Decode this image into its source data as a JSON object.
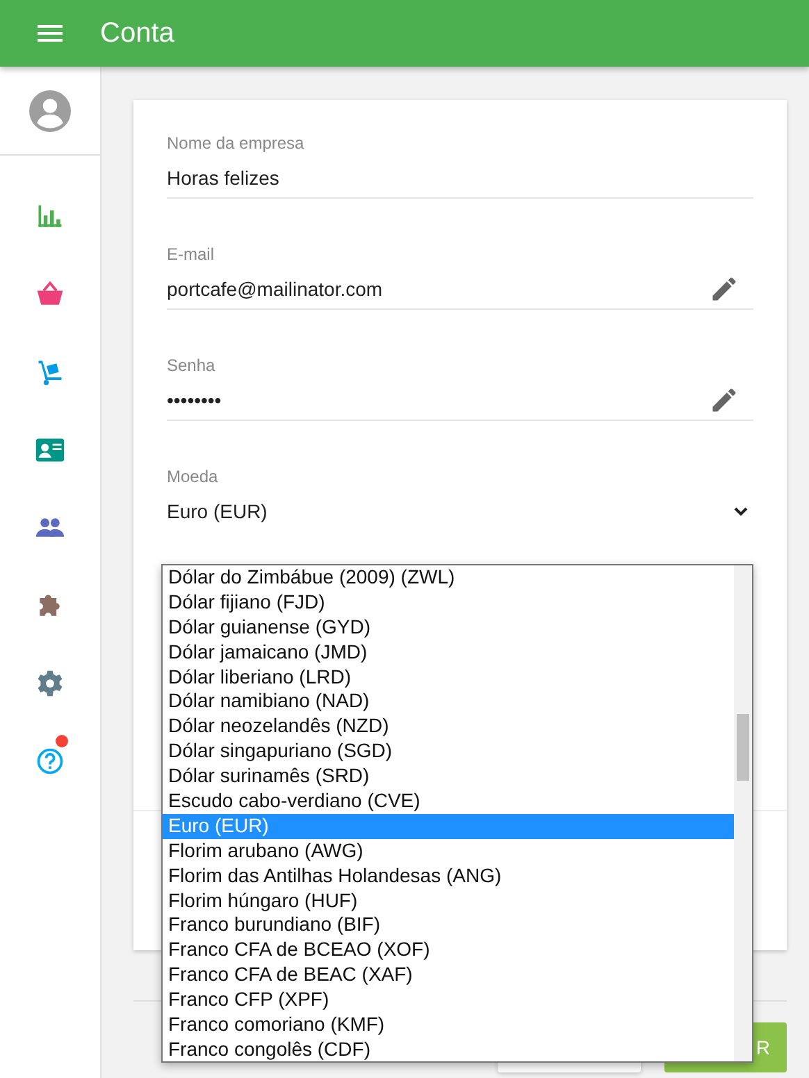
{
  "app_bar": {
    "title": "Conta"
  },
  "sidebar": {
    "items": [
      {
        "kind": "chart",
        "color": "#4caf50"
      },
      {
        "kind": "basket",
        "color": "#ec407a"
      },
      {
        "kind": "trolley",
        "color": "#039be5"
      },
      {
        "kind": "card",
        "color": "#009688"
      },
      {
        "kind": "people",
        "color": "#5c6bc0"
      },
      {
        "kind": "puzzle",
        "color": "#8d6e63"
      },
      {
        "kind": "gear",
        "color": "#607d8b"
      },
      {
        "kind": "help",
        "color": "#03a9f4",
        "badge": true
      }
    ]
  },
  "form": {
    "fields": [
      {
        "kind": "text",
        "label": "Nome da empresa",
        "value": "Horas felizes",
        "editable": false
      },
      {
        "kind": "text",
        "label": "E-mail",
        "value": "portcafe@mailinator.com",
        "editable": true
      },
      {
        "kind": "password",
        "label": "Senha",
        "value": "••••••••",
        "editable": true
      },
      {
        "kind": "select",
        "label": "Moeda",
        "value": "Euro (EUR)"
      }
    ]
  },
  "dropdown": {
    "options": [
      {
        "label": "Dólar do Zimbábue (2009) (ZWL)",
        "selected": false
      },
      {
        "label": "Dólar fijiano (FJD)",
        "selected": false
      },
      {
        "label": "Dólar guianense (GYD)",
        "selected": false
      },
      {
        "label": "Dólar jamaicano (JMD)",
        "selected": false
      },
      {
        "label": "Dólar liberiano (LRD)",
        "selected": false
      },
      {
        "label": "Dólar namibiano (NAD)",
        "selected": false
      },
      {
        "label": "Dólar neozelandês (NZD)",
        "selected": false
      },
      {
        "label": "Dólar singapuriano (SGD)",
        "selected": false
      },
      {
        "label": "Dólar surinamês (SRD)",
        "selected": false
      },
      {
        "label": "Escudo cabo-verdiano (CVE)",
        "selected": false
      },
      {
        "label": "Euro (EUR)",
        "selected": true
      },
      {
        "label": "Florim arubano (AWG)",
        "selected": false
      },
      {
        "label": "Florim das Antilhas Holandesas (ANG)",
        "selected": false
      },
      {
        "label": "Florim húngaro (HUF)",
        "selected": false
      },
      {
        "label": "Franco burundiano (BIF)",
        "selected": false
      },
      {
        "label": "Franco CFA de BCEAO (XOF)",
        "selected": false
      },
      {
        "label": "Franco CFA de BEAC (XAF)",
        "selected": false
      },
      {
        "label": "Franco CFP (XPF)",
        "selected": false
      },
      {
        "label": "Franco comoriano (KMF)",
        "selected": false
      },
      {
        "label": "Franco congolês (CDF)",
        "selected": false
      }
    ]
  },
  "actions": [
    {
      "kind": "plain"
    },
    {
      "kind": "primary",
      "label": "R"
    }
  ]
}
